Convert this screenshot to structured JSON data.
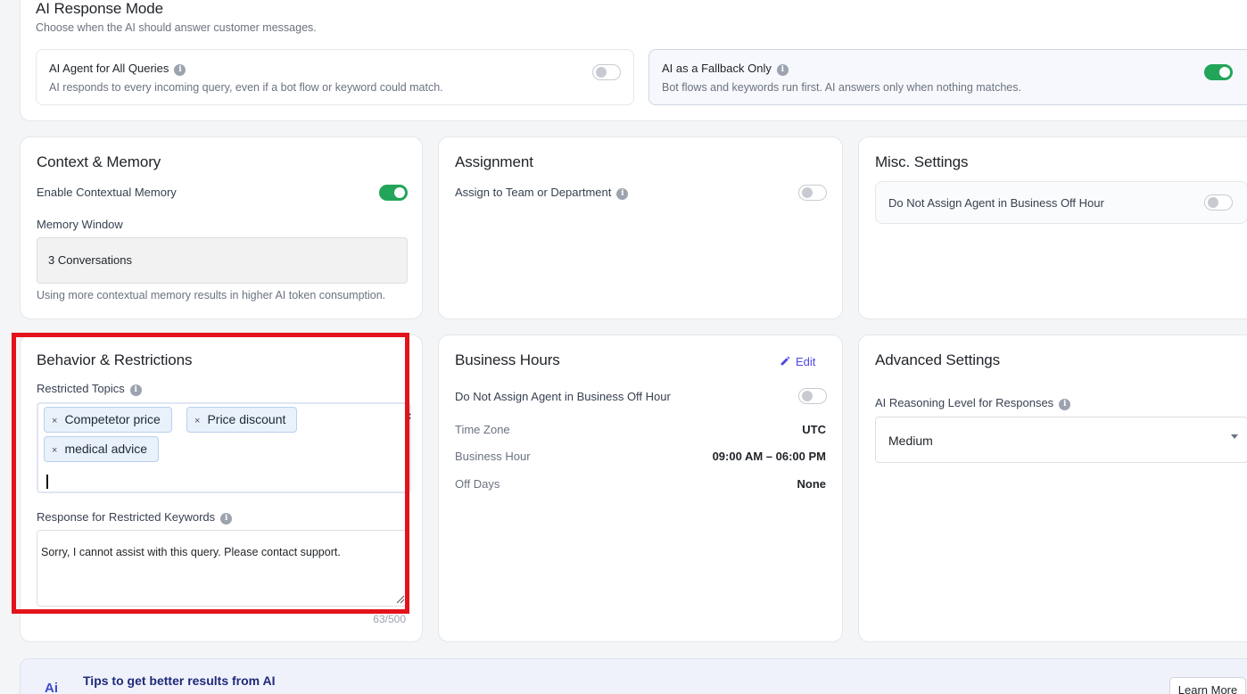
{
  "ai_response_mode": {
    "title": "AI Response Mode",
    "subtitle": "Choose when the AI should answer customer messages.",
    "options": [
      {
        "title": "AI Agent for All Queries",
        "description": "AI responds to every incoming query, even if a bot flow or keyword could match.",
        "enabled": false
      },
      {
        "title": "AI as a Fallback Only",
        "description": "Bot flows and keywords run first. AI answers only when nothing matches.",
        "enabled": true
      }
    ]
  },
  "context_memory": {
    "title": "Context & Memory",
    "enable_label": "Enable Contextual Memory",
    "enabled": true,
    "memory_window_label": "Memory Window",
    "memory_window_value": "3 Conversations",
    "hint": "Using more contextual memory results in higher AI token consumption."
  },
  "assignment": {
    "title": "Assignment",
    "assign_label": "Assign to Team or Department",
    "enabled": false
  },
  "misc": {
    "title": "Misc. Settings",
    "off_hour_label": "Do Not Assign Agent in Business Off Hour",
    "enabled": false
  },
  "behavior": {
    "title": "Behavior & Restrictions",
    "restricted_topics_label": "Restricted Topics",
    "topics": [
      "Competetor price",
      "Price discount",
      "medical advice"
    ],
    "chip_remove": "×",
    "clear_all": "×",
    "response_label": "Response for Restricted Keywords",
    "response_text": "Sorry, I cannot assist with this query. Please contact support.",
    "char_count": "63/500"
  },
  "business_hours": {
    "title": "Business Hours",
    "edit_label": "Edit",
    "off_hour_label": "Do Not Assign Agent in Business Off Hour",
    "enabled": false,
    "rows": [
      {
        "label": "Time Zone",
        "value": "UTC"
      },
      {
        "label": "Business Hour",
        "value": "09:00 AM – 06:00 PM"
      },
      {
        "label": "Off Days",
        "value": "None"
      }
    ]
  },
  "advanced": {
    "title": "Advanced Settings",
    "reasoning_label": "AI Reasoning Level for Responses",
    "reasoning_value": "Medium"
  },
  "tips": {
    "icon_text": "Ai",
    "title": "Tips to get better results from AI",
    "learn_more": "Learn More"
  },
  "icons": {
    "info": "info-icon",
    "edit": "pencil-icon",
    "dropdown": "caret-down-icon"
  },
  "colors": {
    "toggle_on": "#22a559",
    "accent": "#4f46e5",
    "highlight": "#e3131b"
  }
}
